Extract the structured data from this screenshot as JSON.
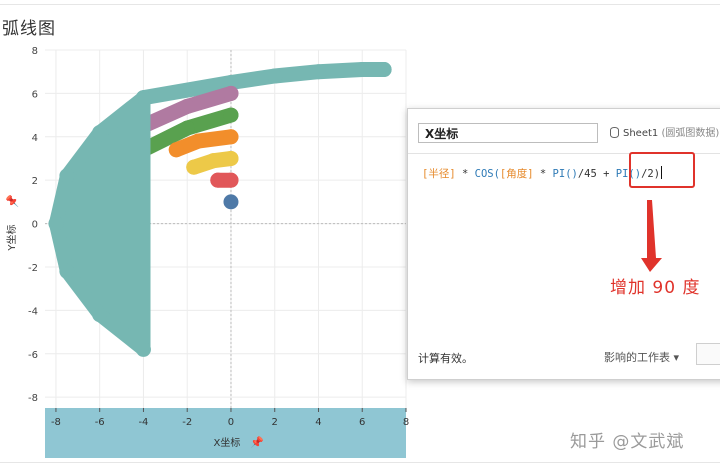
{
  "sheet": {
    "title": "弧线图"
  },
  "chart_data": {
    "type": "scatter",
    "title": "",
    "xlabel": "X坐标",
    "ylabel": "Y坐标",
    "xlim": [
      -8.5,
      8
    ],
    "ylim": [
      -8.5,
      8
    ],
    "xticks": [
      -8,
      -6,
      -4,
      -2,
      0,
      2,
      4,
      6,
      8
    ],
    "yticks": [
      8,
      6,
      4,
      2,
      0,
      -2,
      -4,
      -6,
      -8
    ],
    "grid": true,
    "series": [
      {
        "color": "#76b7b2",
        "radius": 6,
        "x": [
          -4,
          0,
          2,
          4,
          6,
          7
        ],
        "y": [
          5.8,
          6.5,
          6.8,
          7.0,
          7.1,
          7.1
        ]
      },
      {
        "color": "#b07aa1",
        "radius": 5,
        "x": [
          -4,
          -2,
          0
        ],
        "y": [
          4.5,
          5.4,
          6.0
        ]
      },
      {
        "color": "#59a14f",
        "radius": 4,
        "x": [
          -4,
          -2,
          0
        ],
        "y": [
          3.4,
          4.4,
          5.0
        ]
      },
      {
        "color": "#f28e2b",
        "radius": 3,
        "x": [
          -2.5,
          -1.5,
          0
        ],
        "y": [
          3.4,
          3.8,
          4.0
        ]
      },
      {
        "color": "#edc948",
        "radius": 2,
        "x": [
          -1.7,
          -0.8,
          0
        ],
        "y": [
          2.6,
          2.9,
          3.0
        ]
      },
      {
        "color": "#e15759",
        "radius": 1,
        "x": [
          -0.6,
          0
        ],
        "y": [
          2.0,
          2.0
        ]
      },
      {
        "color": "#4e79a7",
        "radius": 0,
        "x": [
          0
        ],
        "y": [
          1.0
        ]
      },
      {
        "color": "#76b7b2",
        "radius": 6,
        "x": [
          -4,
          -6,
          -7.5,
          -8,
          -7.5,
          -6,
          -4
        ],
        "y": [
          5.8,
          4.2,
          2.2,
          0,
          -2.2,
          -4.2,
          -5.8
        ]
      }
    ]
  },
  "calc_dialog": {
    "name": "X坐标",
    "source_label": "Sheet1",
    "source_paren": "(圆弧图数据)",
    "formula": {
      "field_radius": "[半径]",
      "op_mul1": " * ",
      "fn_cos": "COS(",
      "field_angle": "[角度]",
      "op_mul2": " * ",
      "fn_pi1": "PI()",
      "op_div": "/45 + ",
      "fn_pi2": "PI()",
      "tail": "/2)"
    },
    "status": "计算有效。",
    "sheets_label": "影响的工作表 ▾"
  },
  "annotation": {
    "text": "增加 90 度",
    "color": "#e0332b"
  },
  "watermark": {
    "text": "知乎 @文武斌"
  },
  "colors": {
    "axis_band": "#8fc6d3",
    "grid": "#ececec",
    "zero_line": "#bcbcbc"
  }
}
